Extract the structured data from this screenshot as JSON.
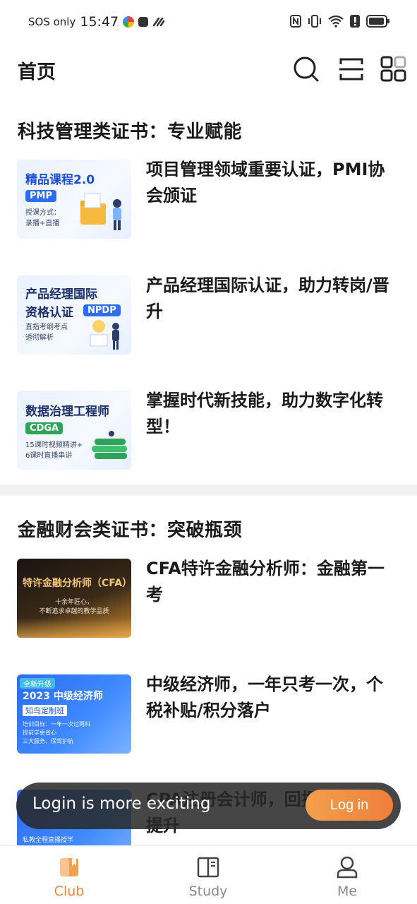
{
  "status_bar": {
    "carrier": "SOS only",
    "time": "15:47"
  },
  "header": {
    "title": "首页",
    "icons": [
      "search-icon",
      "scan-icon",
      "grid-icon"
    ]
  },
  "sections": [
    {
      "title": "科技管理类证书：专业赋能",
      "items": [
        {
          "title": "项目管理领域重要认证，PMI协会颁证",
          "thumb": {
            "big": "精品课程2.0",
            "tag": "PMP",
            "small": [
              "授课方式：",
              "录播+直播"
            ]
          }
        },
        {
          "title": "产品经理国际认证，助力转岗/晋升",
          "thumb": {
            "big": "产品经理国际",
            "big2": "资格认证",
            "tag": "NPDP",
            "small": [
              "直指考纲考点",
              "透彻解析"
            ]
          }
        },
        {
          "title": "掌握时代新技能，助力数字化转型！",
          "thumb": {
            "big": "数据治理工程师",
            "tag": "CDGA",
            "small": [
              "15课时视频精讲+",
              "6课时直播串讲"
            ]
          }
        }
      ]
    },
    {
      "title": "金融财会类证书：突破瓶颈",
      "items": [
        {
          "title": "CFA特许金融分析师：金融第一考",
          "thumb": {
            "big": "特许金融分析师（CFA）",
            "small": [
              "十余年匠心，",
              "不断追求卓越的教学品质"
            ]
          }
        },
        {
          "title": "中级经济师，一年只考一次，个税补贴/积分落户",
          "thumb": {
            "badge": "全新升级",
            "big": "2023 中级经济师",
            "tag": "知鸟定制班",
            "small": [
              "培训目标：一年一次过两科",
              "提前学更省心",
              "三大服务、保驾护航"
            ]
          }
        },
        {
          "title": "CPA注册会计师，回报高，专业提升",
          "thumb": {
            "small": [
              "私教全程直播授学"
            ]
          }
        }
      ]
    }
  ],
  "toast": {
    "text": "Login is more exciting",
    "button": "Log in"
  },
  "bottom_nav": [
    {
      "label": "Club",
      "icon": "club-icon",
      "active": true
    },
    {
      "label": "Study",
      "icon": "book-icon",
      "active": false
    },
    {
      "label": "Me",
      "icon": "person-icon",
      "active": false
    }
  ],
  "colors": {
    "accent": "#e8873a",
    "login_button": "#ee7f3c",
    "thumb_blue": "#2f6df0"
  }
}
